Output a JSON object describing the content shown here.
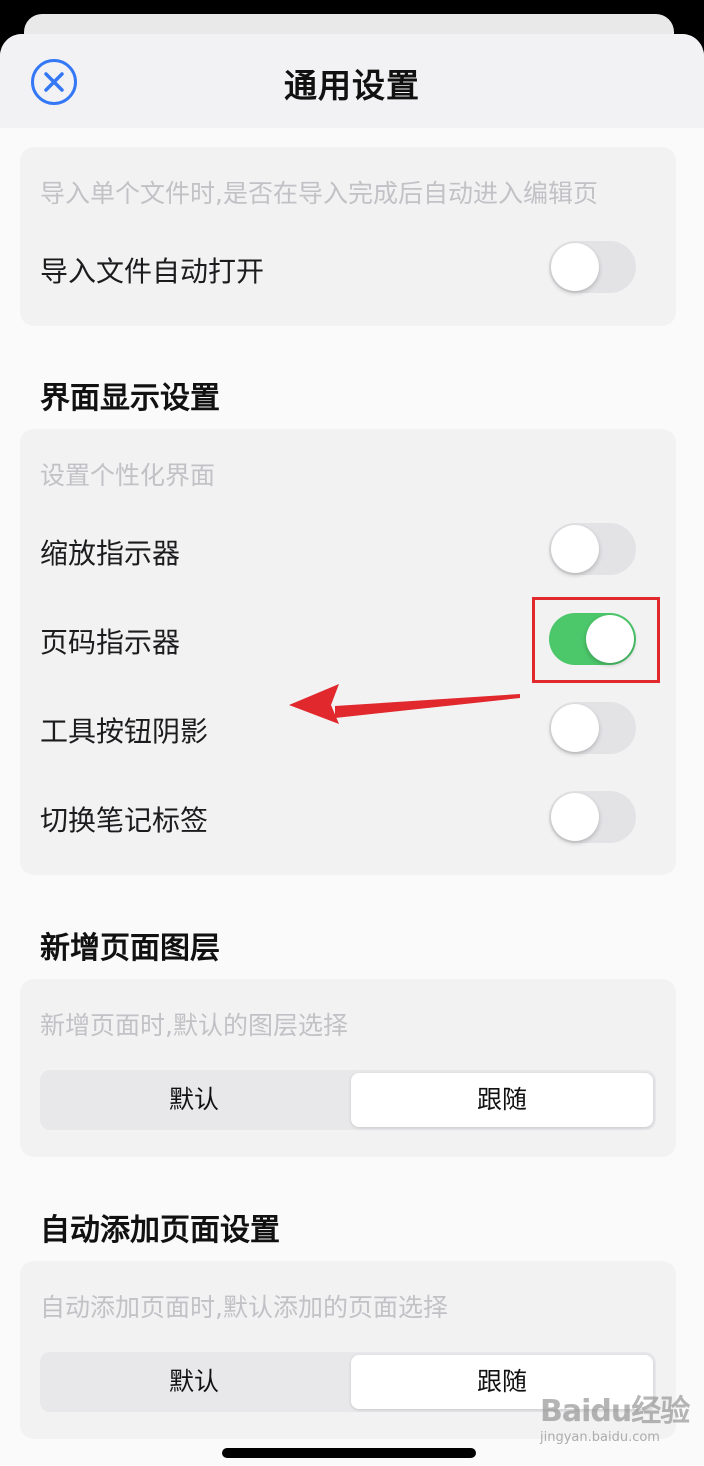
{
  "header": {
    "title": "通用设置"
  },
  "import_card": {
    "description": "导入单个文件时,是否在导入完成后自动进入编辑页",
    "label": "导入文件自动打开",
    "toggle_on": false
  },
  "display_section": {
    "title": "界面显示设置",
    "description": "设置个性化界面",
    "rows": [
      {
        "label": "缩放指示器",
        "toggle_on": false
      },
      {
        "label": "页码指示器",
        "toggle_on": true
      },
      {
        "label": "工具按钮阴影",
        "toggle_on": false
      },
      {
        "label": "切换笔记标签",
        "toggle_on": false
      }
    ]
  },
  "new_page_layer_section": {
    "title": "新增页面图层",
    "description": "新增页面时,默认的图层选择",
    "options": [
      "默认",
      "跟随"
    ],
    "selected": "跟随"
  },
  "auto_add_page_section": {
    "title": "自动添加页面设置",
    "description": "自动添加页面时,默认添加的页面选择",
    "options": [
      "默认",
      "跟随"
    ],
    "selected": "跟随"
  },
  "watermark": {
    "logo": "Baidu经验",
    "url": "jingyan.baidu.com"
  },
  "colors": {
    "accent_blue": "#3478f6",
    "toggle_on": "#4cc76a",
    "annotation_red": "#e0282d"
  },
  "icons": {
    "close": "close-circle-icon",
    "annotation_arrow": "red-arrow-left",
    "watermark_logo": "baidu-paw-logo"
  }
}
